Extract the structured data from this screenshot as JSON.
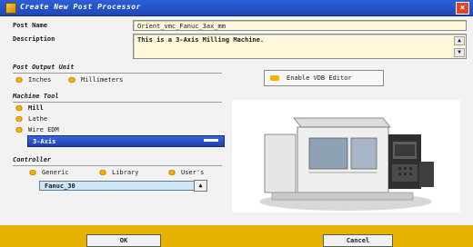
{
  "window": {
    "title": "Create New Post Processor"
  },
  "form": {
    "post_name_label": "Post Name",
    "post_name_value": "Orient_vmc_Fanuc_3ax_mm",
    "description_label": "Description",
    "description_value": "This is a 3-Axis Milling Machine."
  },
  "post_output_unit": {
    "title": "Post Output Unit",
    "options": [
      "Inches",
      "Millimeters"
    ]
  },
  "vdb": {
    "label": "Enable VDB Editor"
  },
  "machine_tool": {
    "title": "Machine Tool",
    "items": [
      "Mill",
      "Lathe",
      "Wire EDM"
    ],
    "selected": "3-Axis"
  },
  "controller": {
    "title": "Controller",
    "options": [
      "Generic",
      "Library",
      "User's"
    ],
    "value": "Fanuc_30"
  },
  "buttons": {
    "ok": "OK",
    "cancel": "Cancel"
  }
}
